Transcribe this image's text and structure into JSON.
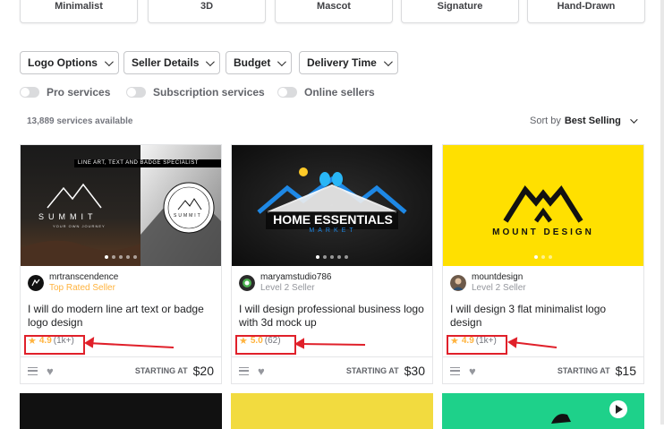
{
  "categories": [
    "Minimalist",
    "3D",
    "Mascot",
    "Signature",
    "Hand-Drawn"
  ],
  "filters": [
    "Logo Options",
    "Seller Details",
    "Budget",
    "Delivery Time"
  ],
  "toggles": [
    "Pro services",
    "Subscription services",
    "Online sellers"
  ],
  "results_count": "13,889 services available",
  "sort": {
    "label": "Sort by",
    "value": "Best Selling"
  },
  "cards": [
    {
      "seller": "mrtranscendence",
      "level": "Top Rated Seller",
      "title": "I will do modern line art text or badge logo design",
      "rating": "4.9",
      "reviews": "(1k+)",
      "starting_label": "STARTING AT",
      "price": "$20",
      "thumb": {
        "banner": "LINE ART, TEXT AND BADGE SPECIALIST",
        "word": "SUMMIT",
        "sub": "YOUR OWN JOURNEY",
        "badge_text": "SUMMIT"
      }
    },
    {
      "seller": "maryamstudio786",
      "level": "Level 2 Seller",
      "title": "I will design professional business logo with 3d mock up",
      "rating": "5.0",
      "reviews": "(62)",
      "starting_label": "STARTING AT",
      "price": "$30",
      "thumb": {
        "word": "HOME ESSENTIALS",
        "sub": "MARKET"
      }
    },
    {
      "seller": "mountdesign",
      "level": "Level 2 Seller",
      "title": "I will design 3 flat minimalist logo design",
      "rating": "4.9",
      "reviews": "(1k+)",
      "starting_label": "STARTING AT",
      "price": "$15",
      "thumb": {
        "word": "MOUNT DESIGN"
      }
    }
  ],
  "colors": {
    "star": "#ffb33e",
    "top_rated": "#ffb33e",
    "highlight": "#e0202a",
    "card3_bg": "#ffe000",
    "card_bottom_2": "#f2db3f",
    "card_bottom_3": "#1ed18a"
  }
}
